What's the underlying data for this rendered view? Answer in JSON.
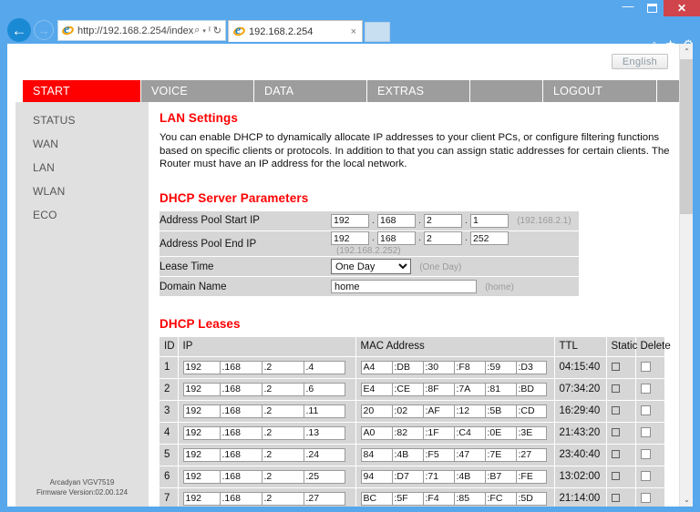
{
  "browser": {
    "window_controls": {
      "minimize": "—",
      "maximize": "❐",
      "close": "✕"
    },
    "back_glyph": "←",
    "forward_glyph": "→",
    "address_value": "http://192.168.2.254/index",
    "address_icons": {
      "search": "⌕",
      "caret": "▾",
      "compat": "ᴵ",
      "refresh": "↻"
    },
    "tab_title": "192.168.2.254",
    "tab_close": "×",
    "chrome_icons": {
      "home": "⌂",
      "favorites": "★",
      "tools": "⚙"
    }
  },
  "page": {
    "language_button": "English",
    "nav": [
      {
        "label": "START",
        "active": true
      },
      {
        "label": "VOICE",
        "active": false
      },
      {
        "label": "DATA",
        "active": false
      },
      {
        "label": "EXTRAS",
        "active": false
      },
      {
        "label": "",
        "active": false
      },
      {
        "label": "LOGOUT",
        "active": false
      }
    ],
    "sidebar": {
      "items": [
        "STATUS",
        "WAN",
        "LAN",
        "WLAN",
        "ECO"
      ],
      "footer_model": "Arcadyan VGV7519",
      "footer_firmware": "Firmware Version:02.00.124"
    },
    "lan_settings": {
      "heading": "LAN Settings",
      "description": "You can enable DHCP to dynamically allocate IP addresses to your client PCs, or configure filtering functions based on specific clients or protocols. In addition to that you can assign static addresses for certain clients. The Router must have an IP address for the local network."
    },
    "dhcp_server": {
      "heading": "DHCP Server Parameters",
      "rows": [
        {
          "label": "Address Pool Start IP",
          "type": "ip",
          "octets": [
            "192",
            "168",
            "2",
            "1"
          ],
          "hint": "(192.168.2.1)"
        },
        {
          "label": "Address Pool End IP",
          "type": "ip",
          "octets": [
            "192",
            "168",
            "2",
            "252"
          ],
          "hint": "(192.168.2.252)"
        },
        {
          "label": "Lease Time",
          "type": "select",
          "value": "One Day",
          "options": [
            "One Day"
          ],
          "hint": "(One Day)"
        },
        {
          "label": "Domain Name",
          "type": "text",
          "value": "home",
          "hint": "(home)"
        }
      ]
    },
    "dhcp_leases": {
      "heading": "DHCP Leases",
      "columns": [
        "ID",
        "IP",
        "MAC Address",
        "TTL",
        "Static",
        "Delete"
      ],
      "rows": [
        {
          "id": "1",
          "ip": [
            "192",
            "168",
            "2",
            "4"
          ],
          "mac": [
            "A4",
            "DB",
            "30",
            "F8",
            "59",
            "D3"
          ],
          "ttl": "04:15:40",
          "static": false,
          "delete": false
        },
        {
          "id": "2",
          "ip": [
            "192",
            "168",
            "2",
            "6"
          ],
          "mac": [
            "E4",
            "CE",
            "8F",
            "7A",
            "81",
            "BD"
          ],
          "ttl": "07:34:20",
          "static": false,
          "delete": false
        },
        {
          "id": "3",
          "ip": [
            "192",
            "168",
            "2",
            "11"
          ],
          "mac": [
            "20",
            "02",
            "AF",
            "12",
            "5B",
            "CD"
          ],
          "ttl": "16:29:40",
          "static": false,
          "delete": false
        },
        {
          "id": "4",
          "ip": [
            "192",
            "168",
            "2",
            "13"
          ],
          "mac": [
            "A0",
            "82",
            "1F",
            "C4",
            "0E",
            "3E"
          ],
          "ttl": "21:43:20",
          "static": false,
          "delete": false
        },
        {
          "id": "5",
          "ip": [
            "192",
            "168",
            "2",
            "24"
          ],
          "mac": [
            "84",
            "4B",
            "F5",
            "47",
            "7E",
            "27"
          ],
          "ttl": "23:40:40",
          "static": false,
          "delete": false
        },
        {
          "id": "6",
          "ip": [
            "192",
            "168",
            "2",
            "25"
          ],
          "mac": [
            "94",
            "D7",
            "71",
            "4B",
            "B7",
            "FE"
          ],
          "ttl": "13:02:00",
          "static": false,
          "delete": false
        },
        {
          "id": "7",
          "ip": [
            "192",
            "168",
            "2",
            "27"
          ],
          "mac": [
            "BC",
            "5F",
            "F4",
            "85",
            "FC",
            "5D"
          ],
          "ttl": "21:14:00",
          "static": false,
          "delete": false
        }
      ]
    },
    "scrollbar": {
      "up": "⌃",
      "down": "⌄"
    }
  },
  "colors": {
    "accent_red": "#fe0000",
    "window_blue": "#57a7ec",
    "nav_gray": "#9d9d9d",
    "table_gray": "#d6d6d6",
    "close_red": "#d0454c"
  }
}
